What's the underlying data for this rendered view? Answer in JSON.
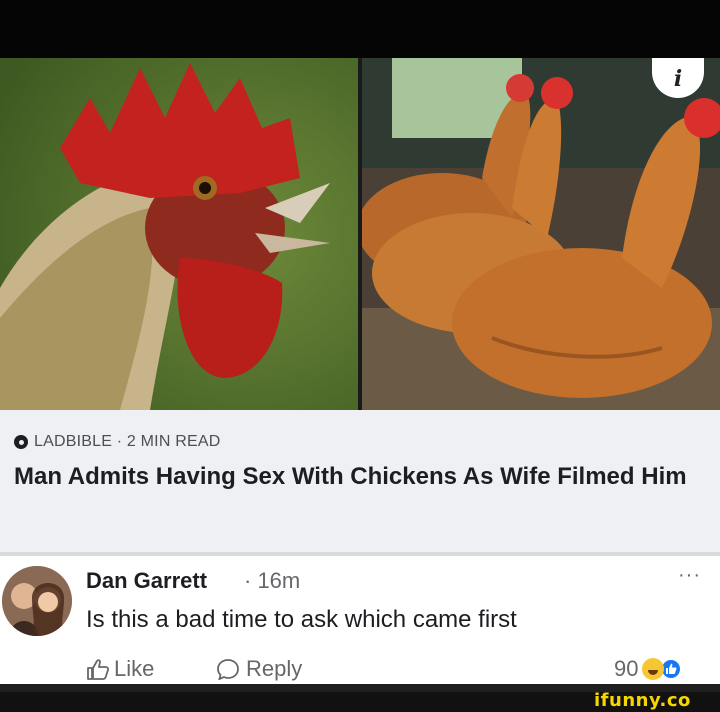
{
  "post": {
    "source": "LADBIBLE · 2 MIN READ",
    "headline": "Man Admits Having Sex With Chickens As Wife Filmed Him",
    "info_icon": "i"
  },
  "comment": {
    "author": "Dan Garrett",
    "time": "· 16m",
    "text": "Is this a bad time to ask which came first",
    "more": "···",
    "like_label": "Like",
    "reply_label": "Reply",
    "reaction_count": "90"
  },
  "watermark": "ifunny.co",
  "colors": {
    "card_bg": "#eef0f3",
    "link_blue": "#1877f2",
    "watermark_yellow": "#f7d600"
  }
}
